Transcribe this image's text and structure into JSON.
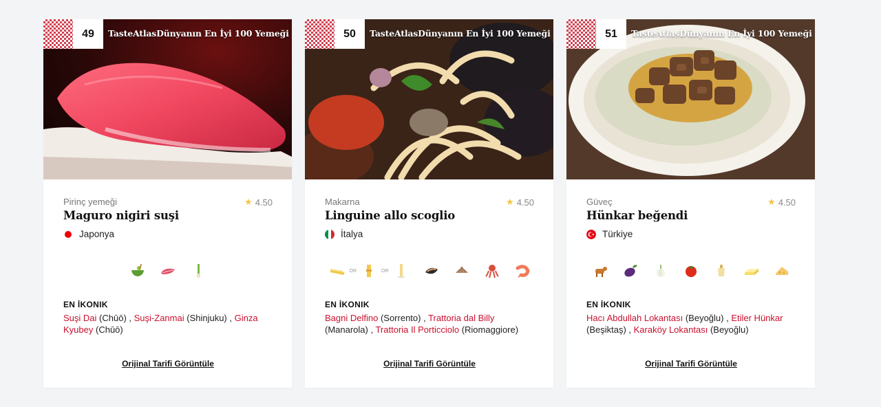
{
  "cards": [
    {
      "rank": "49",
      "overlay_title": "TasteAtlasDünyanın En İyi 100 Yemeği",
      "category": "Pirinç yemeği",
      "rating": "4.50",
      "name": "Maguro nigiri suşi",
      "country": "Japonya",
      "ingredient_icons": [
        "wasabi-bowl-icon",
        "tuna-fillet-icon",
        "scallion-icon"
      ],
      "iconic_label": "EN İKONIK",
      "iconic_places": [
        {
          "name": "Suşi Dai",
          "location": "(Chūō)"
        },
        {
          "name": "Suşi-Zanmai",
          "location": "(Shinjuku)"
        },
        {
          "name": "Ginza Kyubey",
          "location": "(Chūō)"
        }
      ],
      "recipe_link": "Orijinal Tarifi Görüntüle"
    },
    {
      "rank": "50",
      "overlay_title": "TasteAtlasDünyanın En İyi 100 Yemeği",
      "category": "Makarna",
      "rating": "4.50",
      "name": "Linguine allo scoglio",
      "country": "İtalya",
      "ingredient_icons": [
        "linguine-icon",
        "spaghetti-icon",
        "pasta-icon",
        "mussel-icon",
        "clam-icon",
        "octopus-icon",
        "shrimp-icon"
      ],
      "or_label": "OR",
      "iconic_label": "EN İKONIK",
      "iconic_places": [
        {
          "name": "Bagni Delfino",
          "location": "(Sorrento)"
        },
        {
          "name": "Trattoria dal Billy",
          "location": "(Manarola)"
        },
        {
          "name": "Trattoria Il Porticciolo",
          "location": "(Riomaggiore)"
        }
      ],
      "recipe_link": "Orijinal Tarifi Görüntüle"
    },
    {
      "rank": "51",
      "overlay_title": "TasteAtlasDünyanın En İyi 100 Yemeği",
      "category": "Güveç",
      "rating": "4.50",
      "name": "Hünkar beğendi",
      "country": "Türkiye",
      "ingredient_icons": [
        "lamb-icon",
        "eggplant-icon",
        "garlic-icon",
        "tomato-icon",
        "flour-icon",
        "butter-icon",
        "cheese-icon"
      ],
      "iconic_label": "EN İKONIK",
      "iconic_places": [
        {
          "name": "Hacı Abdullah Lokantası",
          "location": "(Beyoğlu)"
        },
        {
          "name": "Etiler Hünkar",
          "location": "(Beşiktaş)"
        },
        {
          "name": "Karaköy Lokantası",
          "location": "(Beyoğlu)"
        }
      ],
      "recipe_link": "Orijinal Tarifi Görüntüle"
    }
  ],
  "colors": {
    "link": "#c8102e",
    "star": "#f5c542",
    "background": "#f3f4f6"
  }
}
